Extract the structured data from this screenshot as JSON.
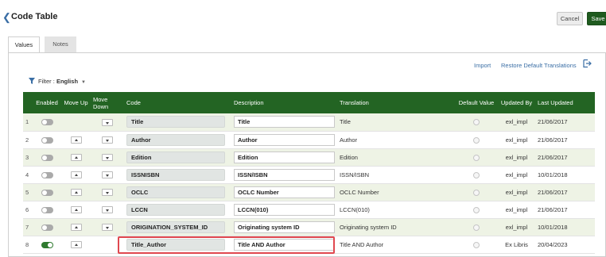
{
  "header": {
    "title": "Code Table",
    "cancel_label": "Cancel",
    "save_label": "Save"
  },
  "tabs": [
    {
      "label": "Values",
      "active": true
    },
    {
      "label": "Notes",
      "active": false
    }
  ],
  "toolbar": {
    "import_label": "Import",
    "restore_label": "Restore Default Translations",
    "export_icon": "export-icon"
  },
  "filter": {
    "label": "Filter :",
    "value": "English"
  },
  "columns": {
    "enabled": "Enabled",
    "move_up": "Move Up",
    "move_down": "Move Down",
    "code": "Code",
    "description": "Description",
    "translation": "Translation",
    "default_value": "Default Value",
    "updated_by": "Updated By",
    "last_updated": "Last Updated"
  },
  "rows": [
    {
      "num": "1",
      "enabled": false,
      "code": "Title",
      "description": "Title",
      "translation": "Title",
      "updated_by": "exl_impl",
      "last_updated": "21/06/2017"
    },
    {
      "num": "2",
      "enabled": false,
      "code": "Author",
      "description": "Author",
      "translation": "Author",
      "updated_by": "exl_impl",
      "last_updated": "21/06/2017"
    },
    {
      "num": "3",
      "enabled": false,
      "code": "Edition",
      "description": "Edition",
      "translation": "Edition",
      "updated_by": "exl_impl",
      "last_updated": "21/06/2017"
    },
    {
      "num": "4",
      "enabled": false,
      "code": "ISSNISBN",
      "description": "ISSN/ISBN",
      "translation": "ISSN/ISBN",
      "updated_by": "exl_impl",
      "last_updated": "10/01/2018"
    },
    {
      "num": "5",
      "enabled": false,
      "code": "OCLC",
      "description": "OCLC Number",
      "translation": "OCLC Number",
      "updated_by": "exl_impl",
      "last_updated": "21/06/2017"
    },
    {
      "num": "6",
      "enabled": false,
      "code": "LCCN",
      "description": "LCCN(010)",
      "translation": "LCCN(010)",
      "updated_by": "exl_impl",
      "last_updated": "21/06/2017"
    },
    {
      "num": "7",
      "enabled": false,
      "code": "ORIGINATION_SYSTEM_ID",
      "description": "Originating system ID",
      "translation": "Originating system ID",
      "updated_by": "exl_impl",
      "last_updated": "10/01/2018"
    },
    {
      "num": "8",
      "enabled": true,
      "code": "Title_Author",
      "description": "Title AND Author",
      "translation": "Title AND Author",
      "updated_by": "Ex Libris",
      "last_updated": "20/04/2023"
    }
  ],
  "colors": {
    "header_green": "#236423",
    "save_green": "#1f5a1f",
    "highlight_red": "#e0484f",
    "link_blue": "#3a6ea5"
  }
}
